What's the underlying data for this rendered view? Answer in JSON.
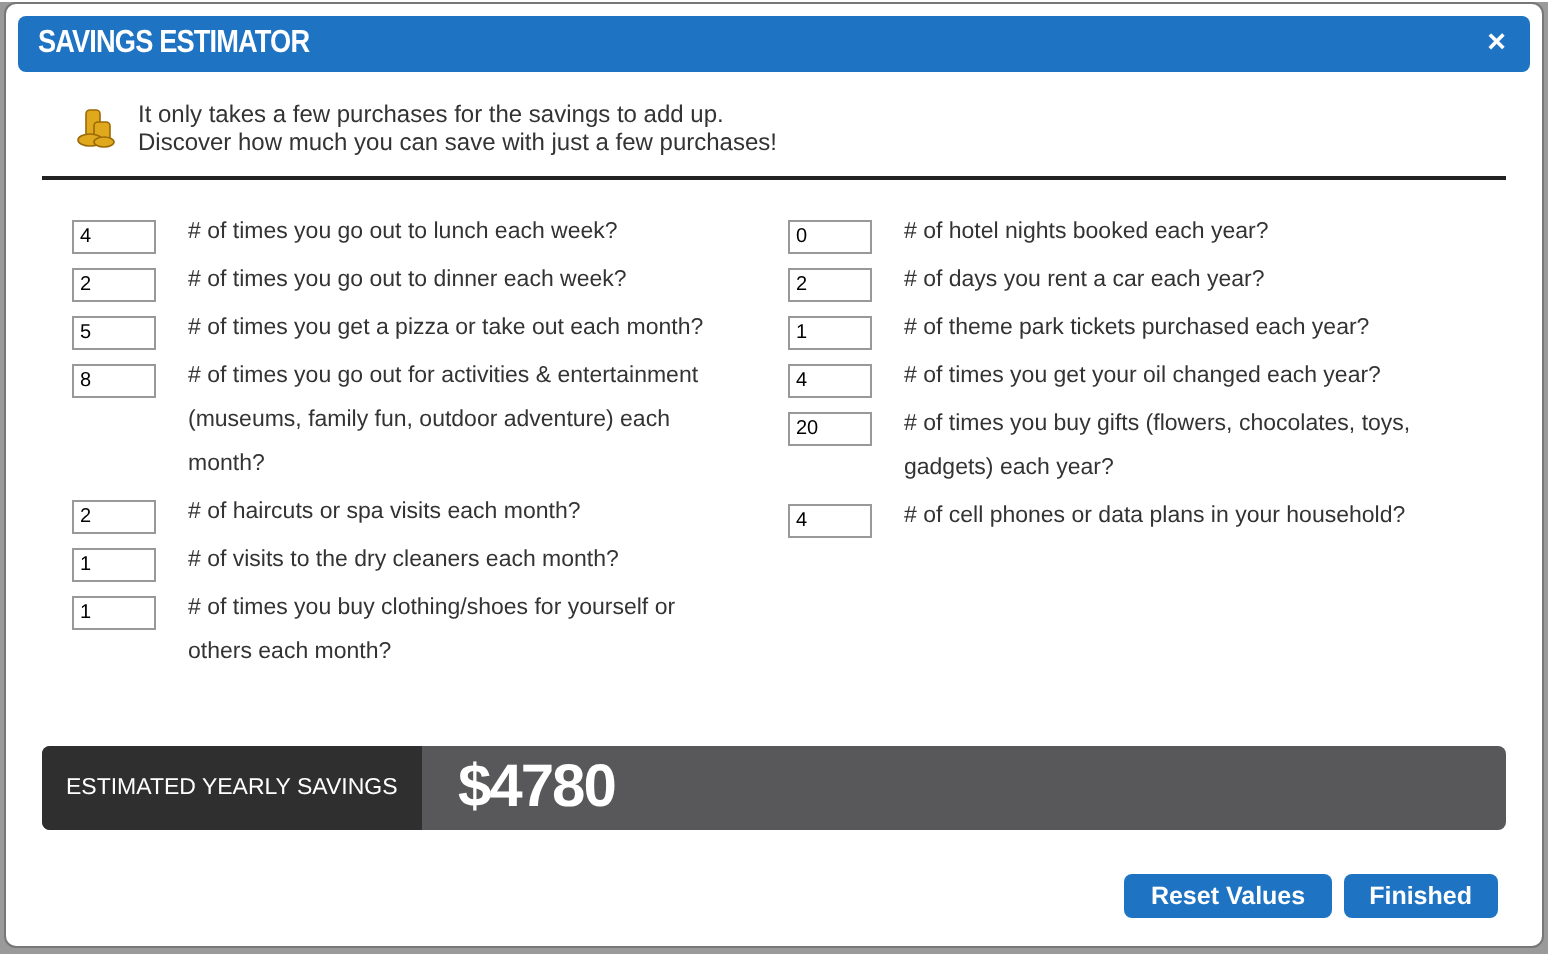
{
  "window": {
    "title": "SAVINGS ESTIMATOR",
    "close": "×"
  },
  "intro": [
    "It only takes a few purchases for the savings to add up.",
    "Discover how much you can save with just a few purchases!"
  ],
  "columns": [
    [
      {
        "value": "4",
        "label": "# of times you go out to lunch each week?"
      },
      {
        "value": "2",
        "label": "# of times you go out to dinner each week?"
      },
      {
        "value": "5",
        "label": "# of times you get a pizza or take out each month?"
      },
      {
        "value": "8",
        "label": "# of times you go out for activities & entertainment (museums, family fun, outdoor adventure) each month?"
      },
      {
        "value": "2",
        "label": "# of haircuts or spa visits each month?"
      },
      {
        "value": "1",
        "label": "# of visits to the dry cleaners each month?"
      },
      {
        "value": "1",
        "label": "# of times you buy clothing/shoes for yourself or others each month?"
      }
    ],
    [
      {
        "value": "0",
        "label": "# of hotel nights booked each year?"
      },
      {
        "value": "2",
        "label": "# of days you rent a car each year?"
      },
      {
        "value": "1",
        "label": "# of theme park tickets purchased each year?"
      },
      {
        "value": "4",
        "label": "# of times you get your oil changed each year?"
      },
      {
        "value": "20",
        "label": "# of times you buy gifts (flowers, chocolates, toys, gadgets) each year?"
      },
      {
        "value": "4",
        "label": "# of cell phones or data plans in your household?"
      }
    ]
  ],
  "savings": {
    "label": "ESTIMATED YEARLY SAVINGS",
    "amount": "$4780"
  },
  "buttons": [
    "Reset Values",
    "Finished"
  ]
}
